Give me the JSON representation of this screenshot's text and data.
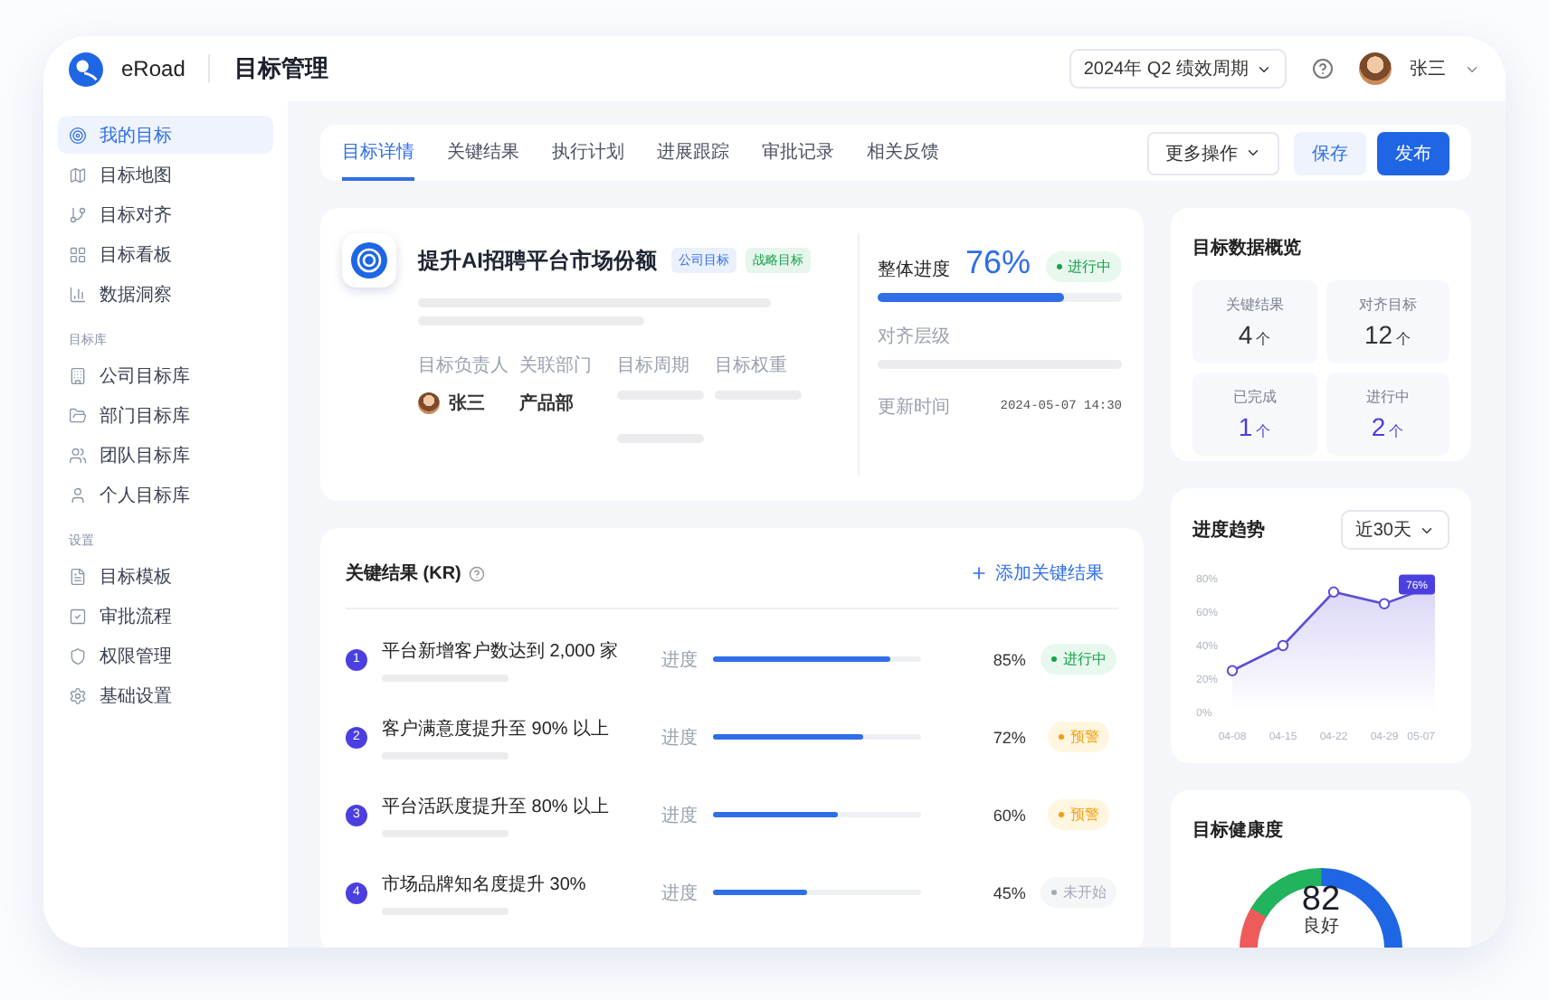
{
  "header": {
    "brand": "eRoad",
    "title": "目标管理",
    "period": "2024年 Q2 绩效周期",
    "user": "张三"
  },
  "sidebar": {
    "sections": [
      {
        "items": [
          {
            "label": "我的目标",
            "selected": true
          },
          {
            "label": "目标地图",
            "selected": false
          },
          {
            "label": "目标对齐",
            "selected": false
          },
          {
            "label": "目标看板",
            "selected": false
          },
          {
            "label": "数据洞察",
            "selected": false
          }
        ]
      },
      {
        "heading": "目标库",
        "items": [
          {
            "label": "公司目标库",
            "selected": false
          },
          {
            "label": "部门目标库",
            "selected": false
          },
          {
            "label": "团队目标库",
            "selected": false
          },
          {
            "label": "个人目标库",
            "selected": false
          }
        ]
      },
      {
        "heading": "设置",
        "items": [
          {
            "label": "目标模板",
            "selected": false
          },
          {
            "label": "审批流程",
            "selected": false
          },
          {
            "label": "权限管理",
            "selected": false
          },
          {
            "label": "基础设置",
            "selected": false
          }
        ]
      }
    ]
  },
  "tabs": [
    {
      "label": "目标详情",
      "selected": true
    },
    {
      "label": "关键结果",
      "selected": false
    },
    {
      "label": "执行计划",
      "selected": false
    },
    {
      "label": "进展跟踪",
      "selected": false
    },
    {
      "label": "审批记录",
      "selected": false
    },
    {
      "label": "相关反馈",
      "selected": false
    }
  ],
  "actions": {
    "more": "更多操作",
    "save": "保存",
    "publish": "发布"
  },
  "objective": {
    "title": "提升AI招聘平台市场份额",
    "tags": [
      {
        "label": "公司目标",
        "color": "#2f6ee6"
      },
      {
        "label": "战略目标",
        "color": "#16a34a"
      }
    ],
    "fields": [
      {
        "label": "目标负责人",
        "value": "张三",
        "kind": "person"
      },
      {
        "label": "关联部门",
        "value": "产品部",
        "kind": "text"
      },
      {
        "label": "目标周期",
        "kind": "pending"
      },
      {
        "label": "目标权重",
        "kind": "pending"
      }
    ],
    "progress": {
      "label": "整体进度",
      "reading": "76%",
      "level": 0.76,
      "status": {
        "label": "进行中",
        "kind": "in_progress"
      }
    },
    "alignment_label": "对齐层级",
    "updated": {
      "label": "更新时间",
      "value": "2024-05-07 14:30"
    }
  },
  "overview": {
    "title": "目标数据概览",
    "stats": [
      {
        "label": "关键结果",
        "value": "4",
        "unit": "个",
        "highlight": false
      },
      {
        "label": "对齐目标",
        "value": "12",
        "unit": "个",
        "highlight": false
      },
      {
        "label": "已完成",
        "value": "1",
        "unit": "个",
        "highlight": true
      },
      {
        "label": "进行中",
        "value": "2",
        "unit": "个",
        "highlight": true
      }
    ]
  },
  "key_results": {
    "title": "关键结果 (KR)",
    "add": "添加关键结果",
    "rows": [
      {
        "index": "1",
        "title": "平台新增客户数达到 2,000 家",
        "progress_label": "进度",
        "level": 0.85,
        "reading": "85%",
        "status": {
          "label": "进行中",
          "kind": "in_progress"
        }
      },
      {
        "index": "2",
        "title": "客户满意度提升至 90% 以上",
        "progress_label": "进度",
        "level": 0.72,
        "reading": "72%",
        "status": {
          "label": "预警",
          "kind": "warning"
        }
      },
      {
        "index": "3",
        "title": "平台活跃度提升至 80% 以上",
        "progress_label": "进度",
        "level": 0.6,
        "reading": "60%",
        "status": {
          "label": "预警",
          "kind": "warning"
        }
      },
      {
        "index": "4",
        "title": "市场品牌知名度提升 30%",
        "progress_label": "进度",
        "level": 0.45,
        "reading": "45%",
        "status": {
          "label": "未开始",
          "kind": "not_started"
        }
      }
    ]
  },
  "trend": {
    "title": "进度趋势",
    "range": "近30天",
    "chart_data": {
      "type": "area",
      "categories": [
        "04-08",
        "04-15",
        "04-22",
        "04-29",
        "05-07"
      ],
      "values": [
        25,
        40,
        72,
        65,
        76
      ],
      "ylim": [
        0,
        80
      ],
      "yticks": [
        {
          "value": 0,
          "label": "0%"
        },
        {
          "value": 20,
          "label": "20%"
        },
        {
          "value": 40,
          "label": "40%"
        },
        {
          "value": 60,
          "label": "60%"
        },
        {
          "value": 80,
          "label": "80%"
        }
      ],
      "annotations": [
        {
          "x": "05-07",
          "y": 76,
          "text": "76%"
        }
      ]
    }
  },
  "health": {
    "title": "目标健康度",
    "score": "82",
    "rating": "良好"
  }
}
